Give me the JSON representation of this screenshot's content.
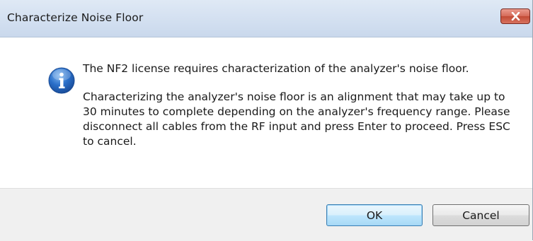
{
  "window": {
    "title": "Characterize Noise Floor",
    "close_icon": "close-x-icon"
  },
  "message": {
    "icon": "info-icon",
    "line1": "The NF2 license requires characterization of the analyzer's noise floor.",
    "line2": "Characterizing the analyzer's noise floor is an alignment that may take up to 30 minutes to complete depending on the analyzer's frequency range.  Please disconnect all cables from the RF input and press Enter to proceed. Press ESC to cancel."
  },
  "buttons": {
    "ok_label": "OK",
    "cancel_label": "Cancel"
  },
  "colors": {
    "titlebar": "#d2dff0",
    "close_button": "#c24a35",
    "info_icon": "#2a6fc9",
    "footer": "#f0f0f0"
  }
}
